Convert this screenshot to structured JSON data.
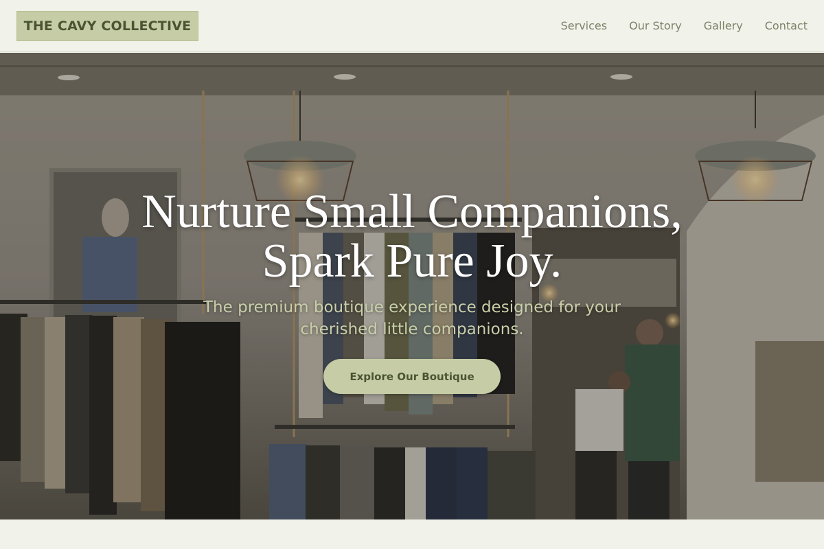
{
  "brand": {
    "name": "THE CAVY COLLECTIVE"
  },
  "nav": {
    "items": [
      {
        "label": "Services"
      },
      {
        "label": "Our Story"
      },
      {
        "label": "Gallery"
      },
      {
        "label": "Contact"
      }
    ]
  },
  "hero": {
    "title_line1": "Nurture Small Companions,",
    "title_line2": "Spark Pure Joy.",
    "subtitle": "The premium boutique experience designed for your cherished little companions.",
    "cta_label": "Explore Our Boutique",
    "background_image": "boutique-interior-photo"
  },
  "colors": {
    "page_bg": "#f1f2e9",
    "accent": "#c6cda6",
    "accent_text": "#4a5433",
    "nav_text": "#7d826a",
    "subtitle_text": "#c9cfa9"
  }
}
